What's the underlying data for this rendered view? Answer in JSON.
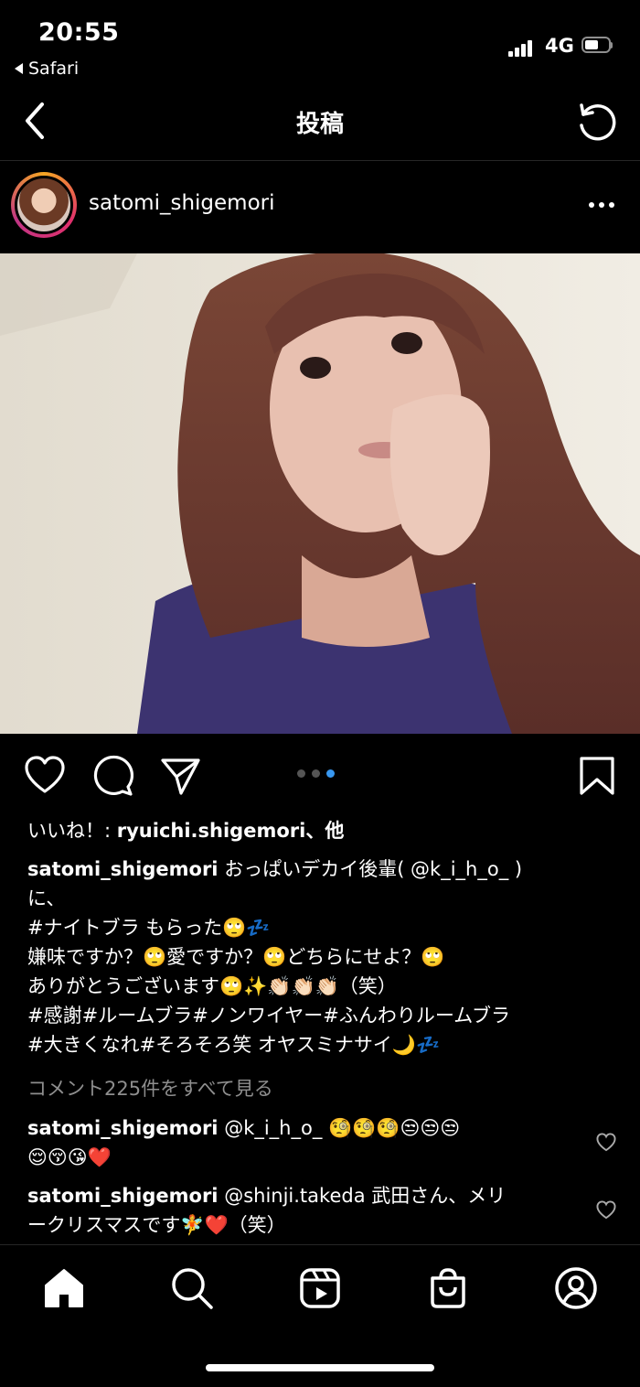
{
  "status_bar": {
    "time": "20:55",
    "back_app": "Safari",
    "network": "4G"
  },
  "nav": {
    "title": "投稿",
    "back_icon": "chevron-left-icon",
    "refresh_icon": "refresh-icon"
  },
  "post": {
    "username": "satomi_shigemori",
    "image_alt": "selfie-photo",
    "carousel": {
      "count": 3,
      "active_index": 2
    }
  },
  "likes": {
    "prefix": "いいね！: ",
    "user": "ryuichi.shigemori",
    "suffix": "、他"
  },
  "caption": {
    "username": "satomi_shigemori",
    "text": " おっぱいデカイ後輩( @k_i_h_o_ )\nに、\n#ナイトブラ もらった🙄💤\n嫌味ですか？🙄愛ですか？🙄どちらにせよ？🙄\nありがとうございます🙄✨👏🏻👏🏻👏🏻（笑）\n#感謝#ルームブラ#ノンワイヤー#ふんわりルームブラ\n#大きくなれ#そろそろ笑 オヤスミナサイ🌙💤"
  },
  "comments": {
    "view_all": "コメント225件をすべて見る",
    "items": [
      {
        "username": "satomi_shigemori",
        "text": " @k_i_h_o_ 🧐🧐🧐😒😒😒\n😌😚😘❤️"
      },
      {
        "username": "satomi_shigemori",
        "text": " @shinji.takeda 武田さん、メリ\nークリスマスです🧚❤️（笑）"
      }
    ]
  },
  "tab_bar": {
    "items": [
      "home-icon",
      "search-icon",
      "reels-icon",
      "shop-icon",
      "profile-icon"
    ]
  },
  "colors": {
    "background": "#000000",
    "accent": "#3897f0",
    "muted_text": "#8e8e8e"
  }
}
